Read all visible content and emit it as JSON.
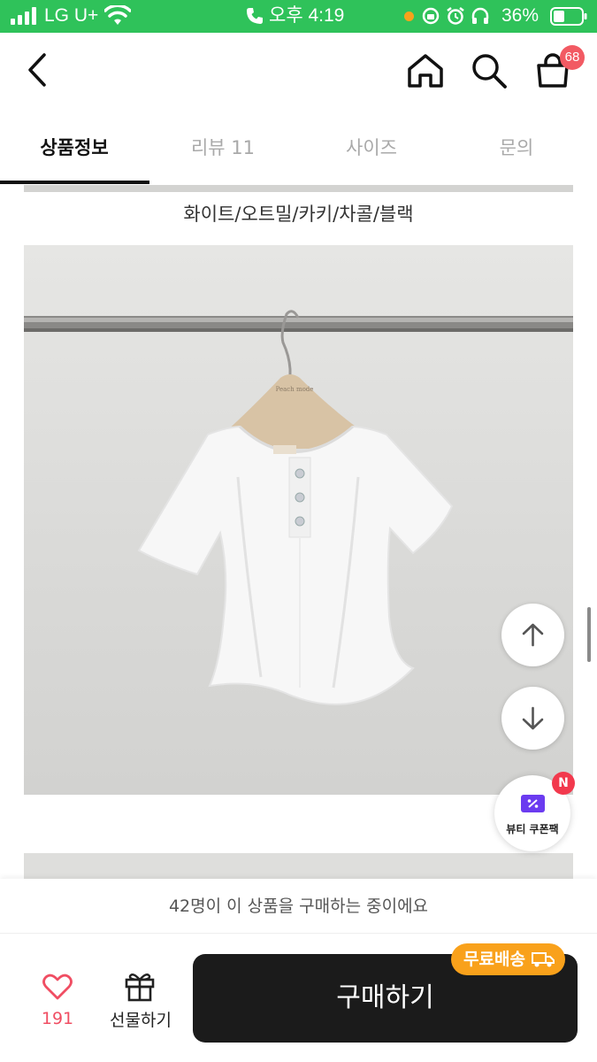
{
  "status_bar": {
    "carrier": "LG U+",
    "time": "오후 4:19",
    "battery": "36%"
  },
  "header": {
    "cart_count": "68"
  },
  "tabs": [
    {
      "label": "상품정보",
      "active": true
    },
    {
      "label": "리뷰 11",
      "active": false
    },
    {
      "label": "사이즈",
      "active": false
    },
    {
      "label": "문의",
      "active": false
    }
  ],
  "content": {
    "color_options": "화이트/오트밀/카키/차콜/블랙",
    "hanger_tag": "Peach mode"
  },
  "floating": {
    "coupon_label": "뷰티 쿠폰팩",
    "coupon_badge": "N"
  },
  "bottom": {
    "purchase_note": "42명이 이 상품을 구매하는 중이에요",
    "likes": "191",
    "gift_label": "선물하기",
    "buy_label": "구매하기",
    "shipping_badge": "무료배송"
  },
  "colors": {
    "status_bar": "#2fc25a",
    "cart_badge": "#f25a63",
    "buy_button": "#1b1b1b",
    "shipping_badge": "#f9a11b",
    "like": "#f04e63",
    "coupon": "#6b3bf0"
  }
}
